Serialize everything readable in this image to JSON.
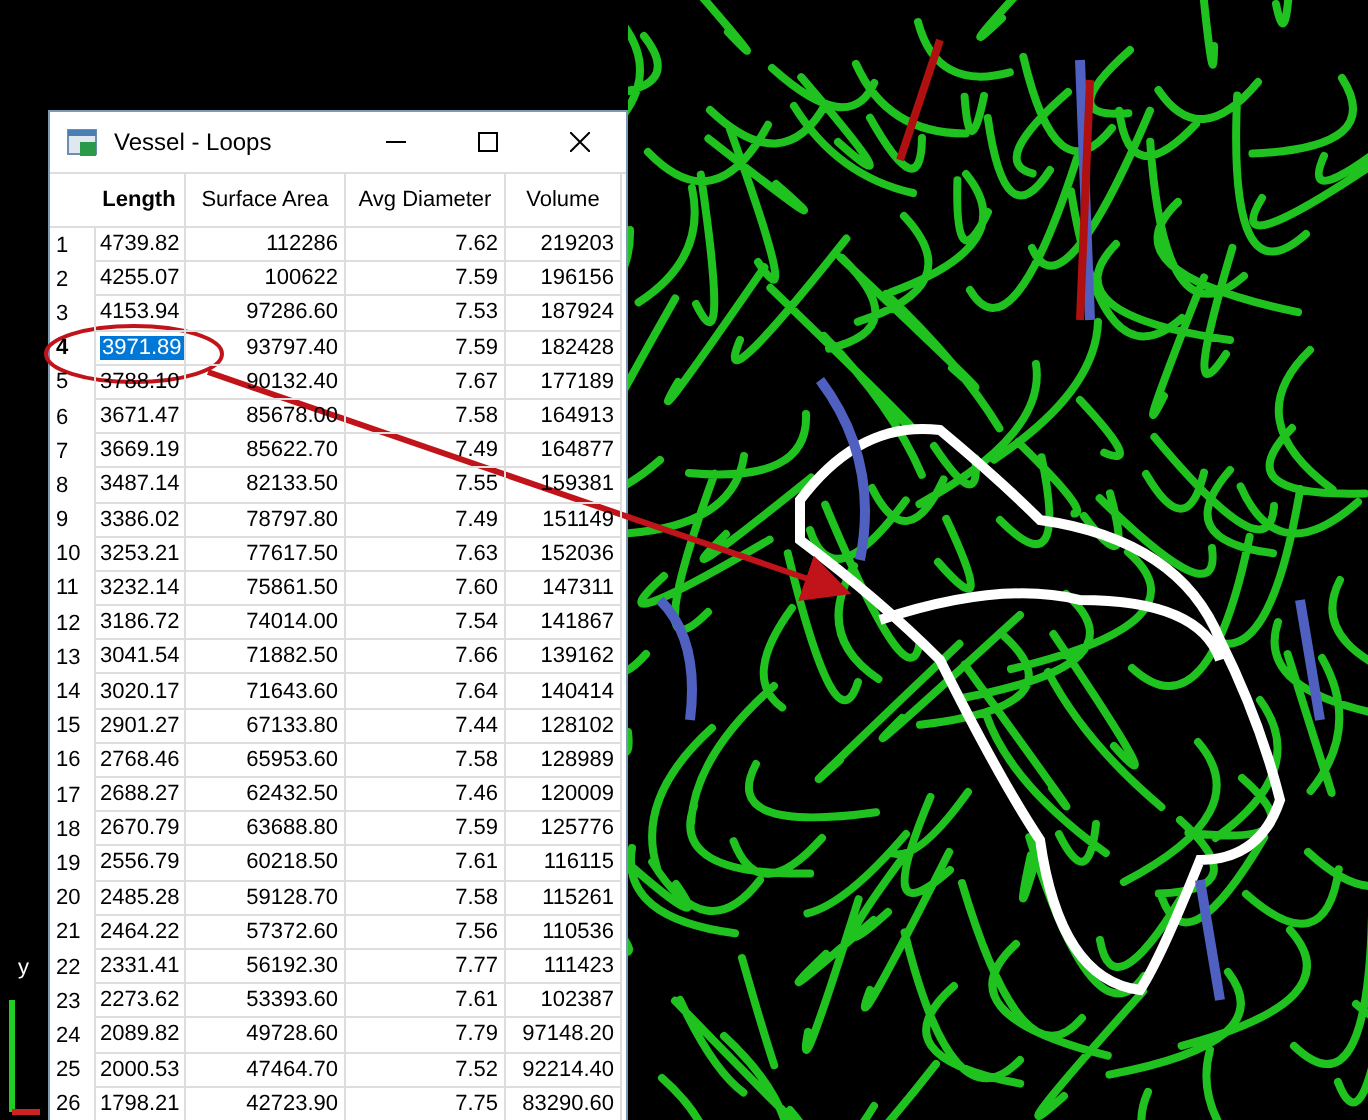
{
  "viewport": {
    "axis_label": "y"
  },
  "window": {
    "title": "Vessel - Loops"
  },
  "table": {
    "columns": [
      {
        "label": "Length",
        "sorted": true
      },
      {
        "label": "Surface Area",
        "sorted": false
      },
      {
        "label": "Avg Diameter",
        "sorted": false
      },
      {
        "label": "Volume",
        "sorted": false
      }
    ],
    "rows": [
      {
        "index": "1",
        "cells": [
          "4739.82",
          "112286",
          "7.62",
          "219203"
        ],
        "selected": false
      },
      {
        "index": "2",
        "cells": [
          "4255.07",
          "100622",
          "7.59",
          "196156"
        ],
        "selected": false
      },
      {
        "index": "3",
        "cells": [
          "4153.94",
          "97286.60",
          "7.53",
          "187924"
        ],
        "selected": false
      },
      {
        "index": "4",
        "cells": [
          "3971.89",
          "93797.40",
          "7.59",
          "182428"
        ],
        "selected": true
      },
      {
        "index": "5",
        "cells": [
          "3788.10",
          "90132.40",
          "7.67",
          "177189"
        ],
        "selected": false
      },
      {
        "index": "6",
        "cells": [
          "3671.47",
          "85678.00",
          "7.58",
          "164913"
        ],
        "selected": false
      },
      {
        "index": "7",
        "cells": [
          "3669.19",
          "85622.70",
          "7.49",
          "164877"
        ],
        "selected": false
      },
      {
        "index": "8",
        "cells": [
          "3487.14",
          "82133.50",
          "7.55",
          "159381"
        ],
        "selected": false
      },
      {
        "index": "9",
        "cells": [
          "3386.02",
          "78797.80",
          "7.49",
          "151149"
        ],
        "selected": false
      },
      {
        "index": "10",
        "cells": [
          "3253.21",
          "77617.50",
          "7.63",
          "152036"
        ],
        "selected": false
      },
      {
        "index": "11",
        "cells": [
          "3232.14",
          "75861.50",
          "7.60",
          "147311"
        ],
        "selected": false
      },
      {
        "index": "12",
        "cells": [
          "3186.72",
          "74014.00",
          "7.54",
          "141867"
        ],
        "selected": false
      },
      {
        "index": "13",
        "cells": [
          "3041.54",
          "71882.50",
          "7.66",
          "139162"
        ],
        "selected": false
      },
      {
        "index": "14",
        "cells": [
          "3020.17",
          "71643.60",
          "7.64",
          "140414"
        ],
        "selected": false
      },
      {
        "index": "15",
        "cells": [
          "2901.27",
          "67133.80",
          "7.44",
          "128102"
        ],
        "selected": false
      },
      {
        "index": "16",
        "cells": [
          "2768.46",
          "65953.60",
          "7.58",
          "128989"
        ],
        "selected": false
      },
      {
        "index": "17",
        "cells": [
          "2688.27",
          "62432.50",
          "7.46",
          "120009"
        ],
        "selected": false
      },
      {
        "index": "18",
        "cells": [
          "2670.79",
          "63688.80",
          "7.59",
          "125776"
        ],
        "selected": false
      },
      {
        "index": "19",
        "cells": [
          "2556.79",
          "60218.50",
          "7.61",
          "116115"
        ],
        "selected": false
      },
      {
        "index": "20",
        "cells": [
          "2485.28",
          "59128.70",
          "7.58",
          "115261"
        ],
        "selected": false
      },
      {
        "index": "21",
        "cells": [
          "2464.22",
          "57372.60",
          "7.56",
          "110536"
        ],
        "selected": false
      },
      {
        "index": "22",
        "cells": [
          "2331.41",
          "56192.30",
          "7.77",
          "111423"
        ],
        "selected": false
      },
      {
        "index": "23",
        "cells": [
          "2273.62",
          "53393.60",
          "7.61",
          "102387"
        ],
        "selected": false
      },
      {
        "index": "24",
        "cells": [
          "2089.82",
          "49728.60",
          "7.79",
          "97148.20"
        ],
        "selected": false
      },
      {
        "index": "25",
        "cells": [
          "2000.53",
          "47464.70",
          "7.52",
          "92214.40"
        ],
        "selected": false
      },
      {
        "index": "26",
        "cells": [
          "1798.21",
          "42723.90",
          "7.75",
          "83290.60"
        ],
        "selected": false
      }
    ]
  }
}
